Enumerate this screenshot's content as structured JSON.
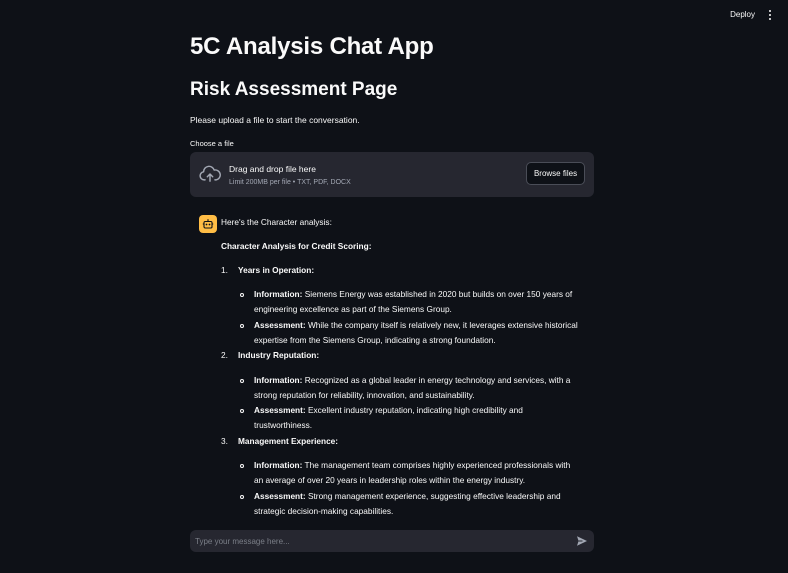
{
  "topbar": {
    "deploy_label": "Deploy",
    "menu_icon": "kebab-menu-icon"
  },
  "page": {
    "app_title": "5C Analysis Chat App",
    "page_title": "Risk Assessment Page",
    "intro": "Please upload a file to start the conversation."
  },
  "uploader": {
    "label": "Choose a file",
    "drag_text": "Drag and drop file here",
    "limit_text": "Limit 200MB per file • TXT, PDF, DOCX",
    "browse_label": "Browse files",
    "icon": "cloud-upload-icon"
  },
  "message": {
    "avatar_icon": "robot-icon",
    "avatar_color": "#ffbd45",
    "intro": "Here's the Character analysis:",
    "heading": "Character Analysis for Credit Scoring:",
    "sections": [
      {
        "number": "1.",
        "title": "Years in Operation:",
        "items": [
          {
            "label": "Information:",
            "lines": [
              " Siemens Energy was established in 2020 but builds on over 150 years of",
              "engineering excellence as part of the Siemens Group."
            ]
          },
          {
            "label": "Assessment:",
            "lines": [
              " While the company itself is relatively new, it leverages extensive historical",
              "expertise from the Siemens Group, indicating a strong foundation."
            ]
          }
        ]
      },
      {
        "number": "2.",
        "title": "Industry Reputation:",
        "items": [
          {
            "label": "Information:",
            "lines": [
              " Recognized as a global leader in energy technology and services, with a",
              "strong reputation for reliability, innovation, and sustainability."
            ]
          },
          {
            "label": "Assessment:",
            "lines": [
              " Excellent industry reputation, indicating high credibility and",
              "trustworthiness."
            ]
          }
        ]
      },
      {
        "number": "3.",
        "title": "Management Experience:",
        "items": [
          {
            "label": "Information:",
            "lines": [
              " The management team comprises highly experienced professionals with",
              "an average of over 20 years in leadership roles within the energy industry."
            ]
          },
          {
            "label": "Assessment:",
            "lines": [
              " Strong management experience, suggesting effective leadership and",
              "strategic decision-making capabilities."
            ]
          }
        ]
      }
    ]
  },
  "chat_input": {
    "placeholder": "Type your message here...",
    "value": "",
    "send_icon": "send-icon"
  },
  "colors": {
    "background": "#0e1117",
    "panel": "#262730",
    "text": "#fafafa",
    "muted": "#a3a8b4"
  }
}
